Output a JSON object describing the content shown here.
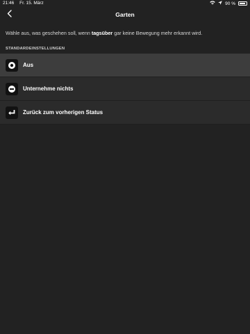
{
  "status_bar": {
    "time": "21:46",
    "date": "Fr. 15. März",
    "battery": "90 %",
    "battery_level": 0.9
  },
  "navbar": {
    "title": "Garten"
  },
  "info": {
    "text_before": "Wähle aus, was geschehen soll, wenn ",
    "highlight": "tagsüber",
    "text_after": " gar keine Bewegung mehr erkannt wird."
  },
  "section": {
    "header": "STANDARDEINSTELLUNGEN"
  },
  "options": [
    {
      "label": "Aus",
      "icon": "power-icon",
      "selected": true
    },
    {
      "label": "Unternehme nichts",
      "icon": "minus-circle-icon",
      "selected": false
    },
    {
      "label": "Zurück zum vorherigen Status",
      "icon": "return-arrow-icon",
      "selected": false
    }
  ],
  "colors": {
    "background": "#222222",
    "row": "#2b2b2b",
    "row_selected": "#3d3d3d",
    "icon_box": "#121212"
  }
}
